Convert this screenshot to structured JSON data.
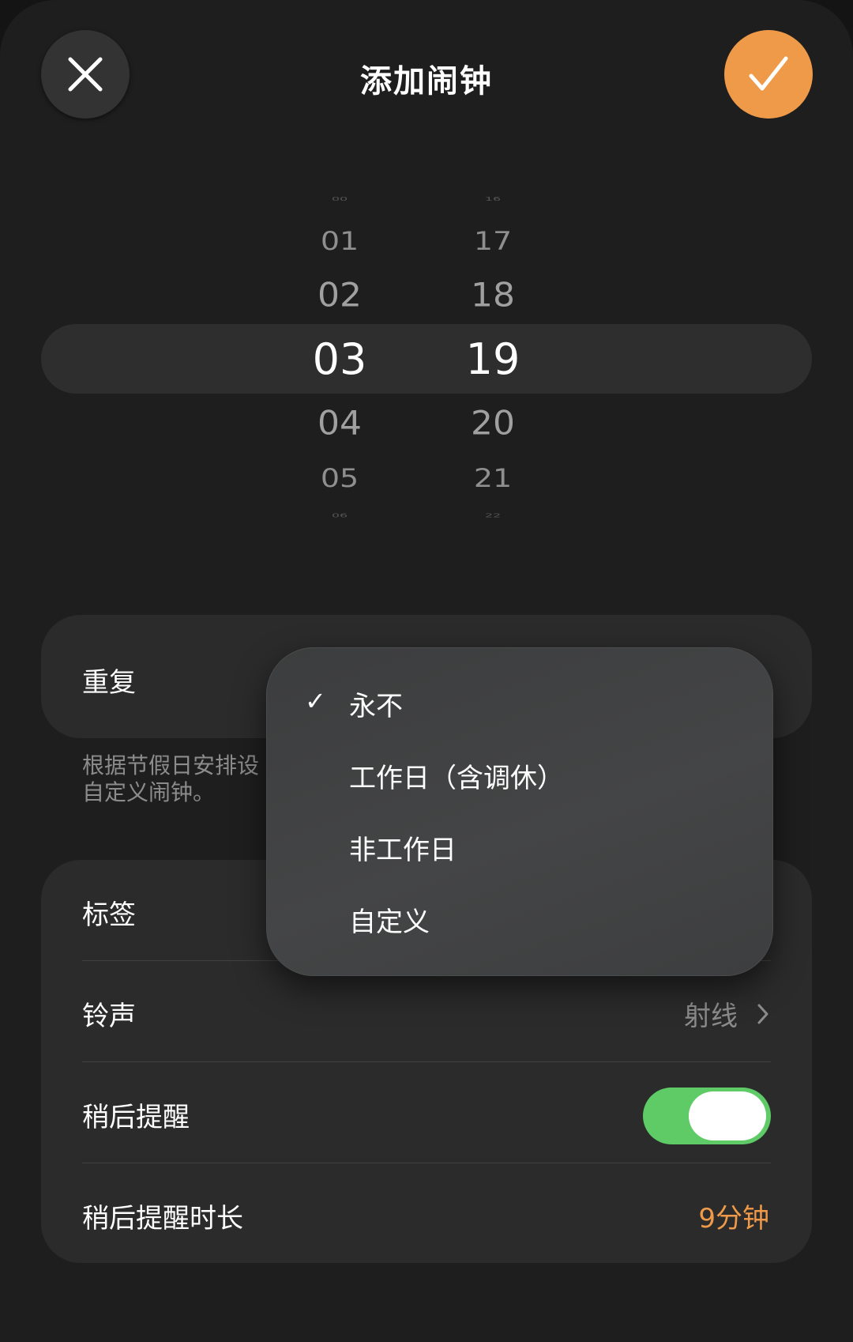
{
  "header": {
    "title": "添加闹钟",
    "close_icon": "close-icon",
    "confirm_icon": "checkmark-icon",
    "confirm_color": "#ef9a48"
  },
  "picker": {
    "hours": [
      "00",
      "01",
      "02",
      "03",
      "04",
      "05",
      "06"
    ],
    "minutes": [
      "16",
      "17",
      "18",
      "19",
      "20",
      "21",
      "22"
    ],
    "selected_hour": "03",
    "selected_minute": "19"
  },
  "repeat": {
    "label": "重复",
    "note": "根据节假日安排设置的闹钟，在节假日期间可能不会响铃；如需提醒，请使用自定义闹钟。",
    "note_visible_line1": "根据节假日安排设",
    "note_visible_line2": "自定义闹钟。"
  },
  "menu": {
    "items": [
      {
        "label": "永不",
        "checked": "✓"
      },
      {
        "label": "工作日（含调休）",
        "checked": ""
      },
      {
        "label": "非工作日",
        "checked": ""
      },
      {
        "label": "自定义",
        "checked": ""
      }
    ]
  },
  "settings": {
    "tag_label": "标签",
    "ringtone_label": "铃声",
    "ringtone_value": "射线",
    "snooze_label": "稍后提醒",
    "snooze_on": true,
    "snooze_duration_label": "稍后提醒时长",
    "snooze_duration_value": "9分钟",
    "toggle_color": "#5fcb67",
    "accent_color": "#ef9a48"
  }
}
